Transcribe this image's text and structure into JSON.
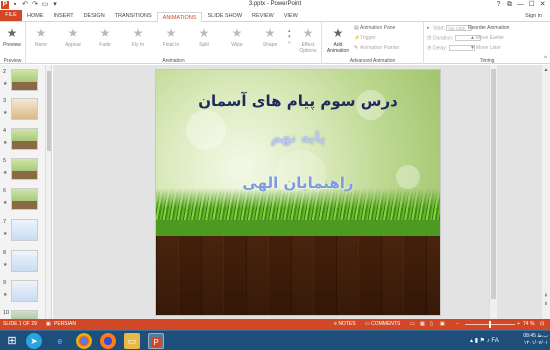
{
  "window": {
    "title": "3.pptx - PowerPoint",
    "qat_icons": [
      "powerpoint-app-icon",
      "save-icon",
      "undo-icon",
      "redo-icon",
      "present-icon",
      "customize-icon"
    ],
    "controls": [
      "?",
      "⧉",
      "—",
      "☐",
      "✕"
    ]
  },
  "tabs": {
    "file": "FILE",
    "items": [
      "HOME",
      "INSERT",
      "DESIGN",
      "TRANSITIONS",
      "ANIMATIONS",
      "SLIDE SHOW",
      "REVIEW",
      "VIEW"
    ],
    "active": "ANIMATIONS",
    "signin": "Sign in"
  },
  "ribbon": {
    "preview": {
      "label": "Preview",
      "group": "Preview"
    },
    "animation_group": "Animation",
    "animations": [
      "None",
      "Appear",
      "Fade",
      "Fly In",
      "Float In",
      "Split",
      "Wipe",
      "Shape"
    ],
    "effect_options": "Effect Options",
    "advanced_group": "Advanced Animation",
    "add_animation": "Add Animation",
    "animation_pane": "Animation Pane",
    "trigger": "Trigger",
    "animation_painter": "Animation Painter",
    "timing_group": "Timing",
    "start_label": "Start:",
    "start_value": "On Click",
    "duration_label": "Duration:",
    "delay_label": "Delay:",
    "reorder_title": "Reorder Animation",
    "move_earlier": "Move Earlier",
    "move_later": "Move Later"
  },
  "thumbnails": [
    {
      "num": "2",
      "style": "slide",
      "star": "★"
    },
    {
      "num": "3",
      "style": "br",
      "star": "★"
    },
    {
      "num": "4",
      "style": "slide",
      "star": "★"
    },
    {
      "num": "5",
      "style": "slide",
      "star": "★"
    },
    {
      "num": "6",
      "style": "slide",
      "star": "★"
    },
    {
      "num": "7",
      "style": "tx",
      "star": "★"
    },
    {
      "num": "8",
      "style": "tx",
      "star": "★"
    },
    {
      "num": "9",
      "style": "tx",
      "star": "★"
    },
    {
      "num": "10",
      "style": "gr",
      "star": ""
    }
  ],
  "slide": {
    "title": "درس سوم پیام های آسمان",
    "subtitle": "پایه نهم",
    "line3": "راهنمایان الهی"
  },
  "status": {
    "slide_of": "SLIDE 1 OF 29",
    "language": "PERSIAN",
    "notes": "NOTES",
    "comments": "COMMENTS",
    "zoom": "74 %",
    "zoom_fraction": 0.5
  },
  "taskbar": {
    "apps": [
      "telegram-icon",
      "internet-explorer-icon",
      "chrome-icon",
      "firefox-icon",
      "file-explorer-icon",
      "powerpoint-icon"
    ],
    "lang": "FA",
    "time": "08:45 ب.ظ",
    "date": "۱۴۰۱/۰۷/۰۱"
  },
  "colors": {
    "accent": "#d24726",
    "taskbar": "#1e4e7a"
  }
}
